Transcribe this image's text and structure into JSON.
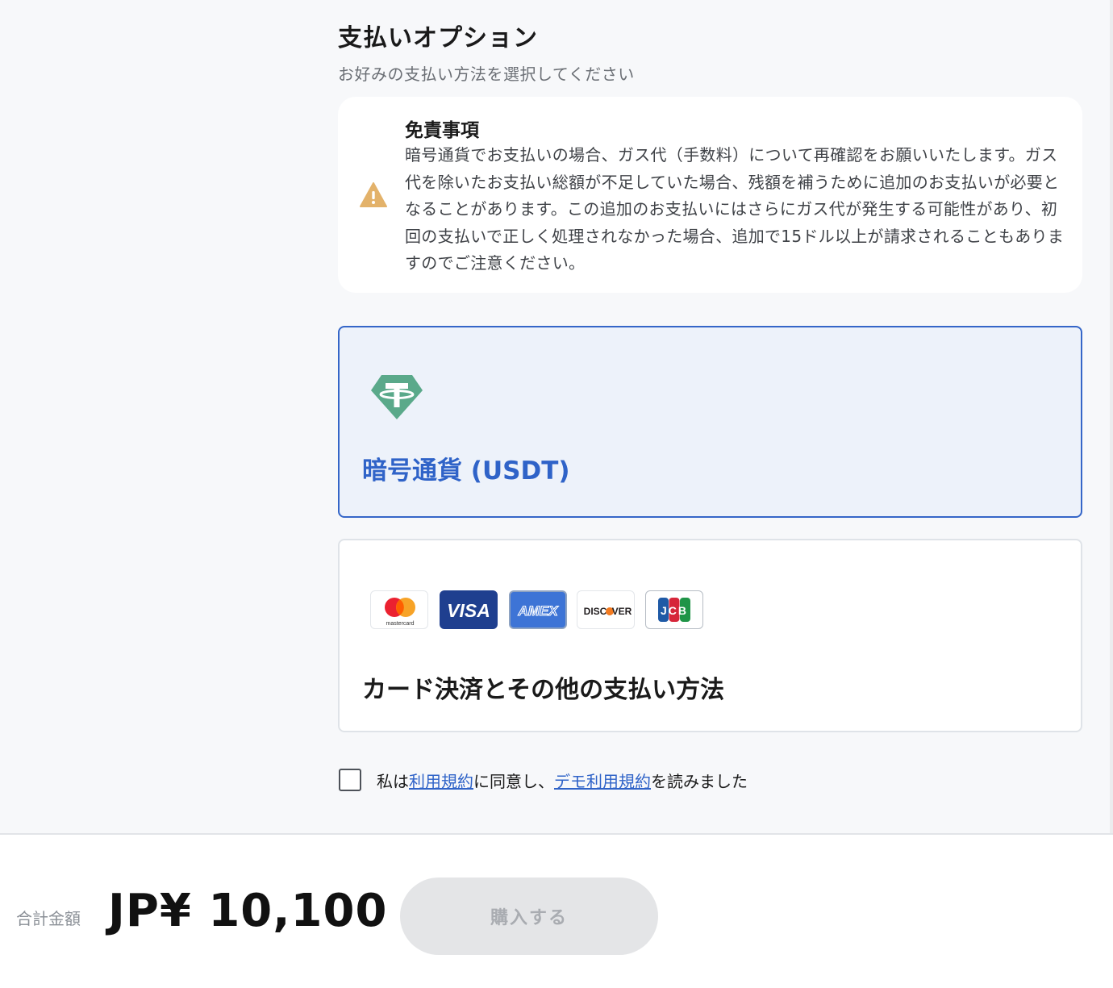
{
  "payment_options": {
    "title": "支払いオプション",
    "subtitle": "お好みの支払い方法を選択してください"
  },
  "disclaimer": {
    "title": "免責事項",
    "body": "暗号通貨でお支払いの場合、ガス代（手数料）について再確認をお願いいたします。ガス代を除いたお支払い総額が不足していた場合、残額を補うために追加のお支払いが必要となることがあります。この追加のお支払いにはさらにガス代が発生する可能性があり、初回の支払いで正しく処理されなかった場合、追加で15ドル以上が請求されることもありますのでご注意ください。"
  },
  "methods": {
    "crypto": {
      "label": "暗号通貨 (USDT)",
      "icon": "tether-icon",
      "selected": true
    },
    "card": {
      "label": "カード決済とその他の支払い方法",
      "logos": {
        "mastercard": "mastercard",
        "visa": "VISA",
        "amex": "AMEX",
        "discover_left": "DISC",
        "discover_right": "VER",
        "jcb": "JCB"
      }
    }
  },
  "terms": {
    "prefix": "私は",
    "link1": "利用規約",
    "middle": "に同意し、",
    "link2": "デモ利用規約",
    "suffix": "を読みました",
    "checked": false
  },
  "footer": {
    "total_label": "合計金額",
    "total_amount": "JP¥ 10,100",
    "buy_label": "購入する",
    "buy_enabled": false
  },
  "colors": {
    "accent": "#2f63c8",
    "warning": "#e3b26a",
    "tether": "#5aa98a"
  }
}
